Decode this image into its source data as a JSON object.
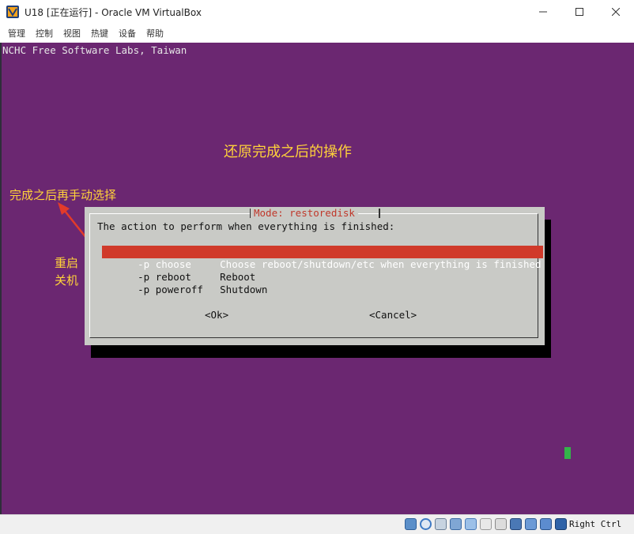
{
  "window": {
    "title": "U18 [正在运行] - Oracle VM VirtualBox",
    "controls": {
      "minimize": "—",
      "maximize": "☐",
      "close": "✕"
    },
    "app_icon": "virtualbox-icon"
  },
  "menu": [
    "管理",
    "控制",
    "视图",
    "热键",
    "设备",
    "帮助"
  ],
  "vm": {
    "header": "NCHC Free Software Labs, Taiwan",
    "annotations": {
      "title": "还原完成之后的操作",
      "left_note": "完成之后再手动选择",
      "side_note": [
        "重启",
        "关机"
      ]
    },
    "dialog": {
      "title": "Mode: restoredisk",
      "prompt": "The action to perform when everything is finished:",
      "options": [
        {
          "tag": "-p choose",
          "desc": "Choose reboot/shutdown/etc when everything is finished",
          "selected": true
        },
        {
          "tag": "-p reboot",
          "desc": "Reboot",
          "selected": false
        },
        {
          "tag": "-p poweroff",
          "desc": "Shutdown",
          "selected": false
        }
      ],
      "ok_label": "<Ok>",
      "cancel_label": "<Cancel>"
    },
    "colors": {
      "background": "#6b2771",
      "dialog": "#c9cac6",
      "highlight": "#d03a2a",
      "annotation": "#ffd23a"
    }
  },
  "statusbar": {
    "icons": [
      "hard-disk-icon",
      "optical-disc-icon",
      "audio-icon",
      "network-icon",
      "usb-icon",
      "shared-folder-icon",
      "display-icon",
      "recording-icon",
      "virtualization-icon",
      "mouse-integration-icon",
      "keyboard-icon"
    ],
    "host_key": "Right Ctrl"
  }
}
